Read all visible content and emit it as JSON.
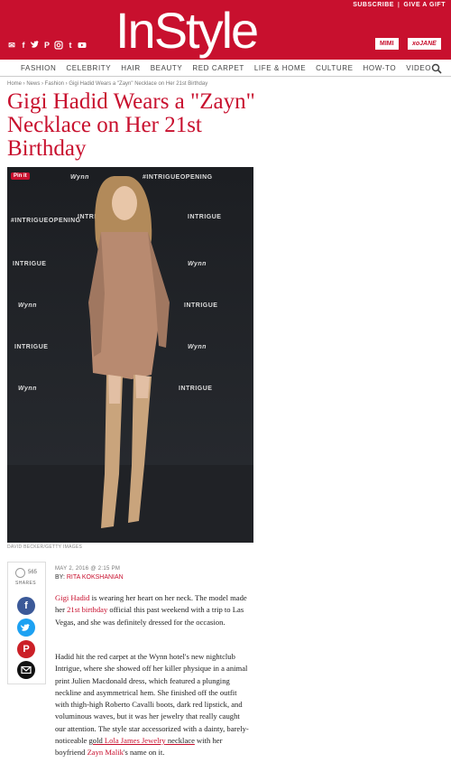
{
  "header": {
    "subscribe": "SUBSCRIBE",
    "separator": "|",
    "give_gift": "GIVE A GIFT",
    "logo": "InStyle",
    "partners": [
      "MIMI",
      "xoJANE"
    ],
    "social_icons": [
      "mail-icon",
      "facebook-icon",
      "twitter-icon",
      "pinterest-icon",
      "instagram-icon",
      "tumblr-icon",
      "youtube-icon"
    ]
  },
  "nav": {
    "items": [
      "FASHION",
      "CELEBRITY",
      "HAIR",
      "BEAUTY",
      "RED CARPET",
      "LIFE & HOME",
      "CULTURE",
      "HOW-TO",
      "VIDEO"
    ]
  },
  "breadcrumb": {
    "text": "Home › News › Fashion › Gigi Hadid Wears a \"Zayn\" Necklace on Her 21st Birthday"
  },
  "article": {
    "title": "Gigi Hadid Wears a \"Zayn\" Necklace on Her 21st Birthday",
    "pin_label": "Pin it",
    "photo_credit": "DAVID BECKER/GETTY IMAGES",
    "backdrop_labels": [
      "#INTRIGUEOPENING",
      "Wynn",
      "INTRIGUE"
    ],
    "date": "MAY 2, 2016 @ 2:15 PM",
    "by_label": "BY: ",
    "author": "RITA KOKSHANIAN",
    "p1": {
      "link1": "Gigi Hadid",
      "t1": " is wearing her heart on her neck. The model made her ",
      "link2": "21st birthday",
      "t2": " official this past weekend with a trip to Las Vegas, and she was definitely dressed for the occasion."
    },
    "p2": {
      "t1": "Hadid hit the red carpet at the Wynn hotel's new nightclub Intrigue, where she showed off her killer physique in a animal print Julien Macdonald dress, which featured a plunging neckline and asymmetrical hem. She finished off the outfit with thigh-high Roberto Cavalli boots, dark red lipstick, and voluminous waves, but it was her jewelry that really caught our attention. The style star accessorized with a dainty, barely-noticeable ",
      "u1": "gold ",
      "link1": "Lola James Jewelry",
      "u2": " necklace",
      "t2": " with her boyfriend ",
      "link2": "Zayn Malik",
      "t3": "'s name on it."
    }
  },
  "share": {
    "count": "565",
    "label": "SHARES",
    "buttons": [
      "facebook-icon",
      "twitter-icon",
      "pinterest-icon",
      "email-icon"
    ]
  },
  "colors": {
    "brand": "#c8102e",
    "facebook": "#3b5998",
    "twitter": "#1da1f2",
    "pinterest": "#cb2027"
  }
}
